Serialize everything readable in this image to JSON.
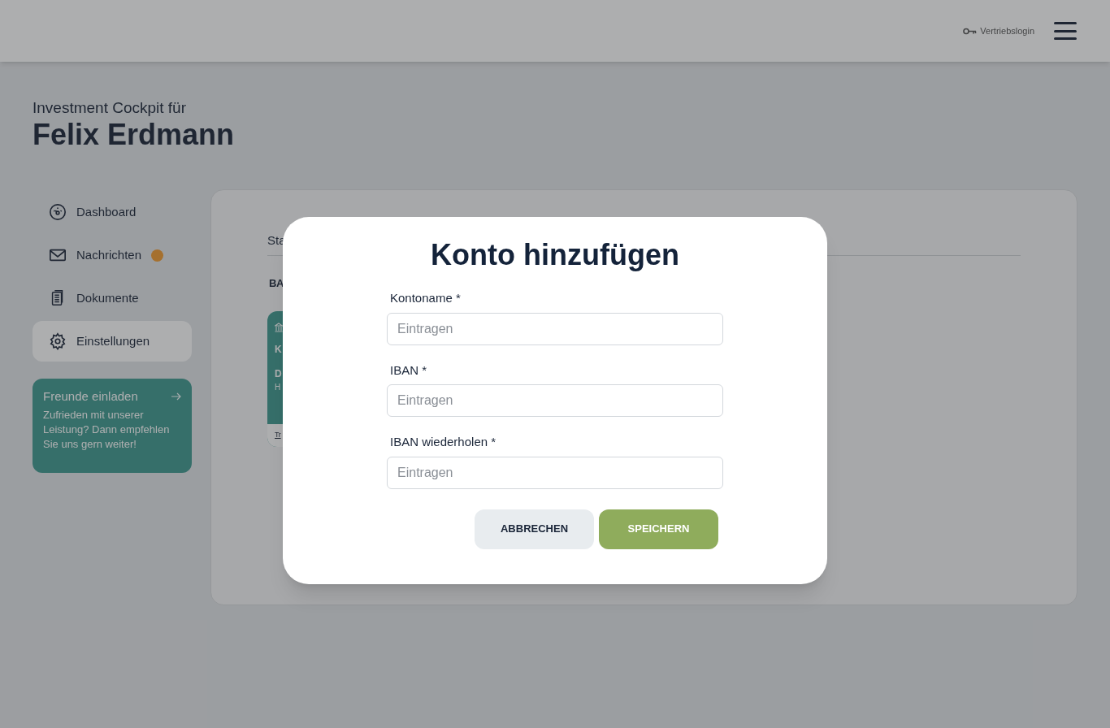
{
  "header": {
    "login_link": "Vertriebslogin"
  },
  "page": {
    "subtitle": "Investment Cockpit für",
    "name": "Felix Erdmann"
  },
  "sidebar": {
    "items": [
      {
        "label": "Dashboard",
        "kind": "dashboard",
        "selected": false,
        "notification": false
      },
      {
        "label": "Nachrichten",
        "kind": "mail",
        "selected": false,
        "notification": true
      },
      {
        "label": "Dokumente",
        "kind": "documents",
        "selected": false,
        "notification": false
      },
      {
        "label": "Einstellungen",
        "kind": "settings",
        "selected": true,
        "notification": false
      }
    ],
    "promo": {
      "title": "Freunde einladen",
      "text": "Zufrieden mit unserer Leistung? Dann empfehlen Sie uns gern weiter!"
    }
  },
  "panel": {
    "tab": "Sta",
    "section": "BA",
    "card": {
      "line_1": "K",
      "line_2": "D",
      "line_3": "H",
      "link": "Tr"
    }
  },
  "dialog": {
    "title": "Konto hinzufügen",
    "fields": [
      {
        "label": "Kontoname *",
        "placeholder": "Eintragen"
      },
      {
        "label": "IBAN *",
        "placeholder": "Eintragen"
      },
      {
        "label": "IBAN wiederholen *",
        "placeholder": "Eintragen"
      }
    ],
    "buttons": [
      {
        "label": "ABBRECHEN",
        "kind": "secondary"
      },
      {
        "label": "SPEICHERN",
        "kind": "primary"
      }
    ]
  }
}
